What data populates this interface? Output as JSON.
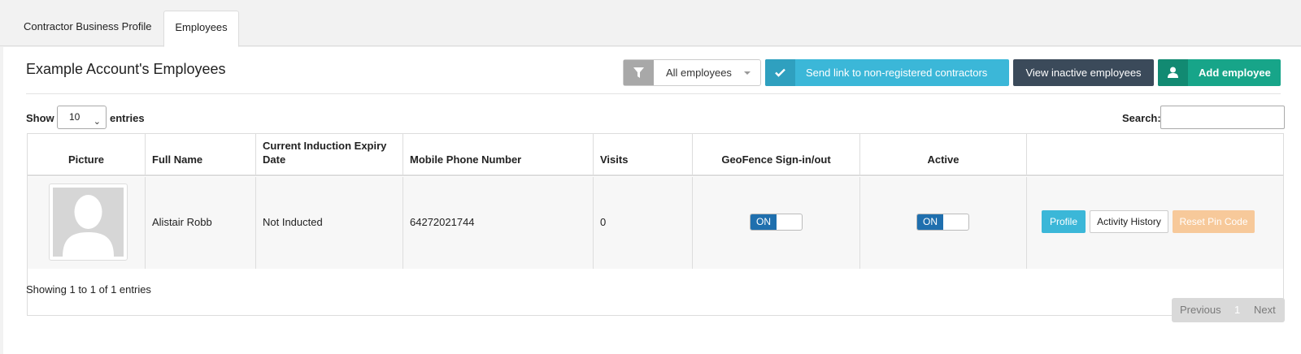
{
  "tabs": [
    {
      "label": "Contractor Business Profile",
      "active": false
    },
    {
      "label": "Employees",
      "active": true
    }
  ],
  "page": {
    "title": "Example Account's Employees"
  },
  "toolbar": {
    "filter_value": "All employees",
    "send_link_label": "Send link to non-registered contractors",
    "view_inactive_label": "View inactive employees",
    "add_employee_label": "Add employee"
  },
  "table_controls": {
    "show_label": "Show",
    "page_length": "10",
    "entries_label": "entries",
    "search_label": "Search:",
    "search_value": ""
  },
  "table": {
    "headers": [
      "Picture",
      "Full Name",
      "Current Induction Expiry Date",
      "Mobile Phone Number",
      "Visits",
      "GeoFence Sign-in/out",
      "Active",
      ""
    ],
    "rows": [
      {
        "full_name": "Alistair Robb",
        "induction_expiry": "Not Inducted",
        "mobile": "64272021744",
        "visits": "0",
        "geofence": "ON",
        "active": "ON",
        "actions": {
          "profile": "Profile",
          "activity": "Activity History",
          "reset": "Reset Pin Code"
        }
      }
    ]
  },
  "footer": {
    "info": "Showing 1 to 1 of 1 entries",
    "previous": "Previous",
    "current_page": "1",
    "next": "Next"
  },
  "colors": {
    "info_blue": "#3bb7d8",
    "dark_slate": "#3b4a5a",
    "green": "#17a589",
    "switch_on": "#1f6fae",
    "warning_light": "#f7c99a"
  }
}
